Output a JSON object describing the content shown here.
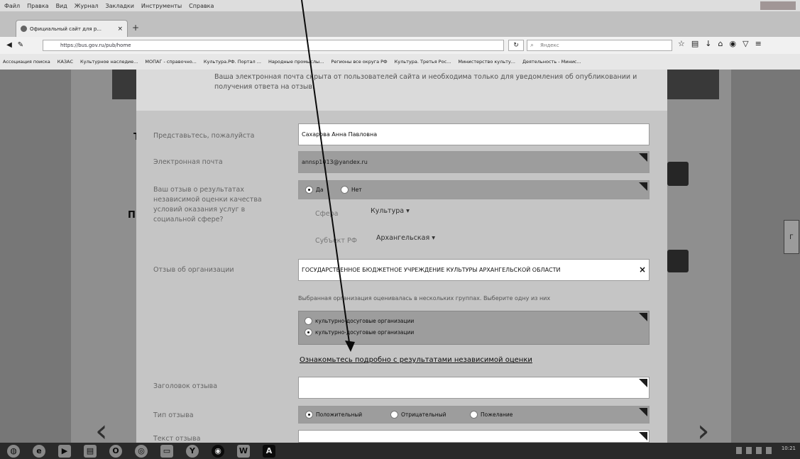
{
  "browser": {
    "menu": [
      "Файл",
      "Правка",
      "Вид",
      "Журнал",
      "Закладки",
      "Инструменты",
      "Справка"
    ],
    "tab_title": "Официальный сайт для р...",
    "url": "https://bus.gov.ru/pub/home",
    "search_placeholder": "Яндекс",
    "bookmarks": [
      "Ассоциация поиска",
      "КАЗАС",
      "Культурное наследие...",
      "МОПАГ - справочно...",
      "Культура.РФ. Портал ...",
      "Народные промыслы...",
      "Регионы все округа РФ",
      "Культура. Третья Рос...",
      "Министерство культу...",
      "Деятельность - Минис..."
    ]
  },
  "form": {
    "note": "Ваша электронная почта скрыта от пользователей сайта и необходима только для уведомления об опубликовании и получения ответа на отзыв.",
    "name_label": "Представьтесь, пожалуйста",
    "name_value": "Сахарова Анна Павловна",
    "email_label": "Электронная почта",
    "email_value": "annsp1013@yandex.ru",
    "question_label": "Ваш отзыв о результатах независимой оценки качества условий оказания услуг в социальной сфере?",
    "yes_label": "Да",
    "no_label": "Нет",
    "sphere_label": "Сфера",
    "sphere_value": "Культура",
    "subject_label": "Субъект РФ",
    "subject_value": "Архангельская",
    "org_label": "Отзыв об организации",
    "org_value": "ГОСУДАРСТВЕННОЕ БЮДЖЕТНОЕ УЧРЕЖДЕНИЕ КУЛЬТУРЫ АРХАНГЕЛЬСКОЙ ОБЛАСТИ",
    "group_hint": "Выбранная организация оценивалась в нескольких группах. Выберите одну из них",
    "group_options": [
      "культурно-досуговые организации",
      "культурно-досуговые организации"
    ],
    "detail_link": "Ознакомьтесь подробно с результатами независимой оценки",
    "title_label": "Заголовок отзыва",
    "type_label": "Тип отзыва",
    "type_options": [
      "Положительный",
      "Отрицательный",
      "Пожелание"
    ],
    "text_label": "Текст отзыва"
  },
  "page": {
    "side_letter_left": "П",
    "side_letter_right": "Г"
  },
  "taskbar": {
    "clock": "10:21"
  }
}
